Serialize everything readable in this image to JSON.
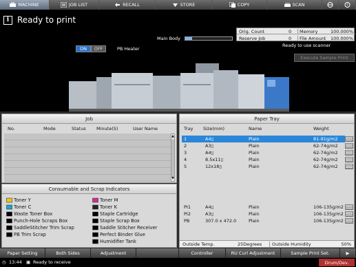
{
  "tabs": [
    {
      "label": "MACHINE",
      "icon": "machine-icon"
    },
    {
      "label": "JOB LIST",
      "icon": "job-list-icon"
    },
    {
      "label": "RECALL",
      "icon": "recall-icon"
    },
    {
      "label": "STORE",
      "icon": "store-icon"
    },
    {
      "label": "COPY",
      "icon": "copy-icon"
    },
    {
      "label": "SCAN",
      "icon": "scan-icon"
    }
  ],
  "header": {
    "status_title": "Ready to print",
    "main_body_label": "Main Body",
    "main_body_progress": 0.15,
    "counters": {
      "orig_count_label": "Orig. Count",
      "orig_count_value": "0",
      "memory_label": "Memory",
      "memory_value": "100.000%",
      "reserve_job_label": "Reserve Job",
      "reserve_job_value": "0",
      "file_amount_label": "File Amount",
      "file_amount_value": "100.000%"
    }
  },
  "machine": {
    "on_label": "ON",
    "off_label": "OFF",
    "pb_heater_label": "PB Heater",
    "scanner_status": "Ready to use scanner",
    "execute_sample_print": "Execute Sample Print"
  },
  "job": {
    "title": "Job",
    "columns": [
      "No.",
      "Mode",
      "Status",
      "Minute(S)",
      "User Name"
    ]
  },
  "tray": {
    "title": "Paper Tray",
    "columns": [
      "Tray",
      "Size(mm)",
      "Name",
      "Weight"
    ],
    "rows": [
      {
        "tray": "1",
        "size": "A4▯",
        "name": "Plain",
        "weight": "81-91g/m2",
        "selected": true
      },
      {
        "tray": "2",
        "size": "A3▯",
        "name": "Plain",
        "weight": "62-74g/m2",
        "selected": false
      },
      {
        "tray": "3",
        "size": "A4▯",
        "name": "Plain",
        "weight": "62-74g/m2",
        "selected": false
      },
      {
        "tray": "4",
        "size": "8.5x11▯",
        "name": "Plain",
        "weight": "62-74g/m2",
        "selected": false
      },
      {
        "tray": "5",
        "size": "12x18▯",
        "name": "Plain",
        "weight": "62-74g/m2",
        "selected": false
      },
      {
        "tray": "PI1",
        "size": "A4▯",
        "name": "Plain",
        "weight": "106-135g/m2",
        "selected": false
      },
      {
        "tray": "PI2",
        "size": "A3▯",
        "name": "Plain",
        "weight": "106-135g/m2",
        "selected": false
      },
      {
        "tray": "PB",
        "size": "307.0 x 472.0",
        "name": "Plain",
        "weight": "106-135g/m2",
        "selected": false
      }
    ],
    "outside_temp_label": "Outside Temp.",
    "outside_temp_value": "25Degrees",
    "outside_humidity_label": "Outside Humidity",
    "outside_humidity_value": "50%"
  },
  "consumables": {
    "title": "Consumable and Scrap Indicators",
    "left": [
      {
        "label": "Toner Y",
        "color": "#e8c81a"
      },
      {
        "label": "Toner C",
        "color": "#1aa3d9"
      },
      {
        "label": "Waste Toner Box",
        "color": "#000000"
      },
      {
        "label": "Punch-Hole Scraps Box",
        "color": "#000000"
      },
      {
        "label": "SaddleStitcher Trim Scrap",
        "color": "#000000"
      },
      {
        "label": "PB Trim Scrap",
        "color": "#000000"
      }
    ],
    "right": [
      {
        "label": "Toner M",
        "color": "#d0308a"
      },
      {
        "label": "Toner K",
        "color": "#222222"
      },
      {
        "label": "Staple Cartridge",
        "color": "#000000"
      },
      {
        "label": "Staple Scrap Box",
        "color": "#000000"
      },
      {
        "label": "Saddle Stitcher Receiver",
        "color": "#000000"
      },
      {
        "label": "Perfect Binder Glue",
        "color": "#000000"
      },
      {
        "label": "Humidifier Tank",
        "color": "#000000"
      }
    ]
  },
  "bottom_bar": [
    "Paper Setting",
    "Both Sides",
    "Adjustment",
    "",
    "Controller",
    "RU Curl Adjustment",
    "Sample Print Set.",
    "▶"
  ],
  "status_bar": {
    "time": "13:44",
    "message": "Ready to receive",
    "drum_button": "Drum/Dev."
  }
}
